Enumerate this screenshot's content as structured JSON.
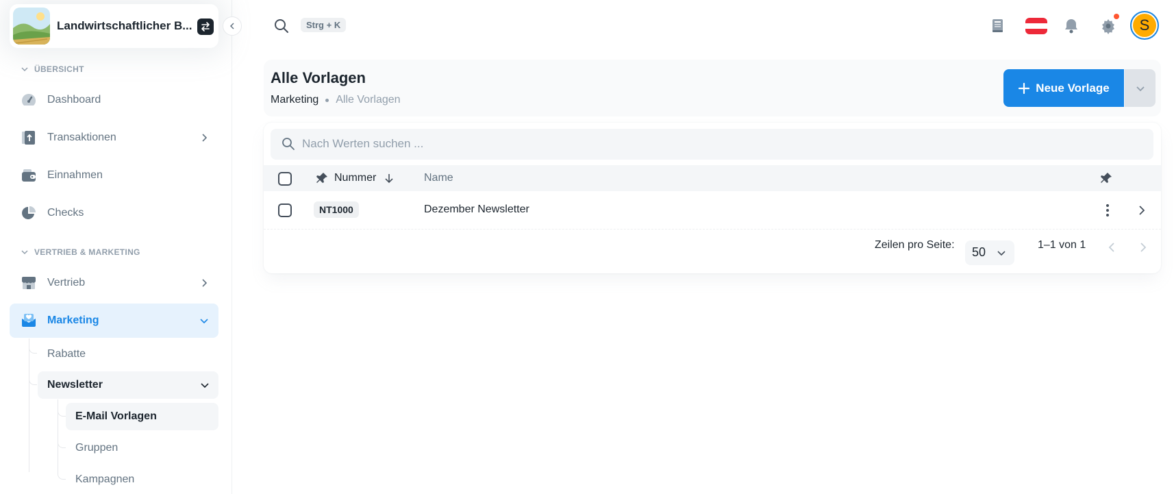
{
  "workspace": {
    "name": "Landwirtschaftlicher B..."
  },
  "sidebar": {
    "section_overview": "ÜBERSICHT",
    "section_sales": "VERTRIEB & MARKETING",
    "items": [
      {
        "label": "Dashboard",
        "icon": "speedometer-icon"
      },
      {
        "label": "Transaktionen",
        "icon": "transfer-icon"
      },
      {
        "label": "Einnahmen",
        "icon": "wallet-icon"
      },
      {
        "label": "Checks",
        "icon": "pie-chart-icon"
      },
      {
        "label": "Vertrieb",
        "icon": "store-icon"
      },
      {
        "label": "Marketing",
        "icon": "mail-heart-icon"
      }
    ],
    "marketing_sub": {
      "rabatte": "Rabatte",
      "newsletter": "Newsletter",
      "email_vorlagen": "E-Mail Vorlagen",
      "gruppen": "Gruppen",
      "kampagnen": "Kampagnen"
    }
  },
  "header": {
    "shortcut": "Strg + K",
    "language_flag": "austria-flag-icon"
  },
  "page": {
    "title": "Alle Vorlagen",
    "breadcrumb": [
      "Marketing",
      "Alle Vorlagen"
    ],
    "new_button": "Neue Vorlage"
  },
  "table": {
    "search_placeholder": "Nach Werten suchen ...",
    "columns": {
      "number": "Nummer",
      "name": "Name"
    },
    "rows": [
      {
        "number": "NT1000",
        "name": "Dezember Newsletter"
      }
    ],
    "rows_per_page_label": "Zeilen pro Seite:",
    "rows_per_page": "50",
    "range": "1–1 von 1"
  },
  "user": {
    "initial": "S"
  },
  "colors": {
    "primary": "#1a87e6",
    "avatar": "#ffab00",
    "notification_dot": "#ff5630"
  }
}
